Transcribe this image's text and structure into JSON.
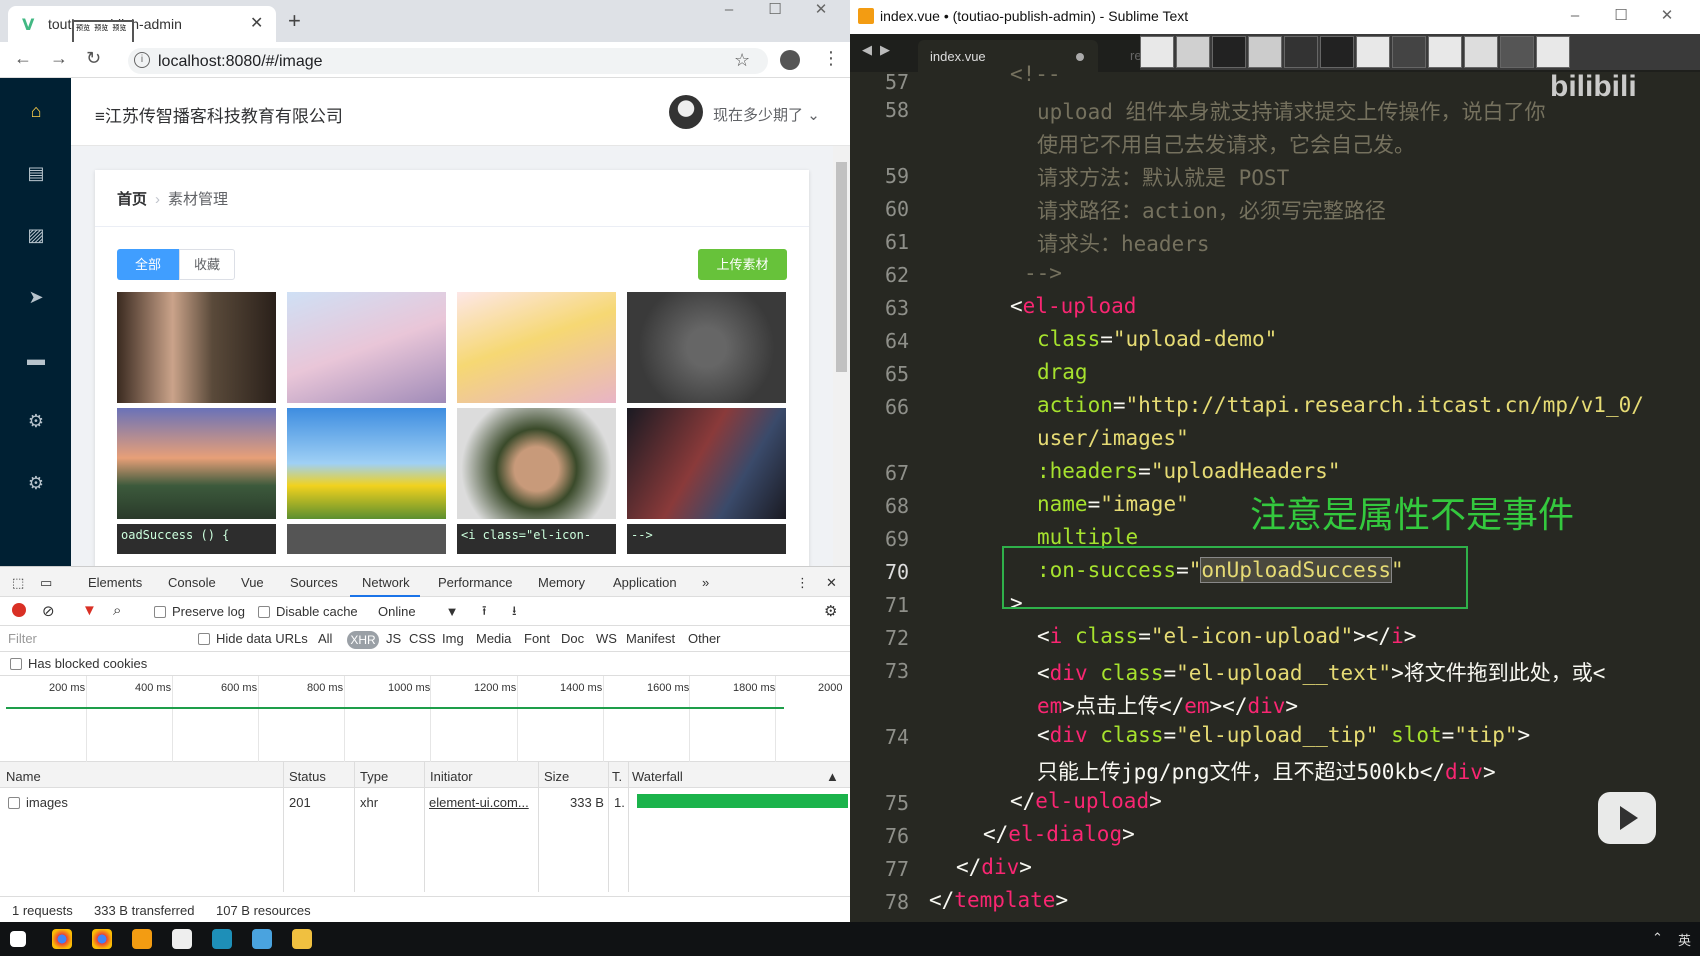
{
  "browser": {
    "tab_title": "toutiao-publish-admin",
    "thumb_popup": "预览 预览 预览",
    "url": "localhost:8080/#/image",
    "new_tab": "+"
  },
  "app": {
    "company": "江苏传智播客科技教育有限公司",
    "username": "现在多少期了",
    "breadcrumb": {
      "home": "首页",
      "current": "素材管理"
    },
    "radio_all": "全部",
    "radio_fav": "收藏",
    "upload_button": "上传素材",
    "partial_tiles": [
      "oadSuccess () {",
      "",
      "<i class=\"el-icon-",
      "-->"
    ]
  },
  "devtools": {
    "tabs": [
      "Elements",
      "Console",
      "Vue",
      "Sources",
      "Network",
      "Performance",
      "Memory",
      "Application",
      "»"
    ],
    "preserve_log": "Preserve log",
    "disable_cache": "Disable cache",
    "throttle": "Online",
    "filter_placeholder": "Filter",
    "hide_data_urls": "Hide data URLs",
    "types": [
      "All",
      "XHR",
      "JS",
      "CSS",
      "Img",
      "Media",
      "Font",
      "Doc",
      "WS",
      "Manifest",
      "Other"
    ],
    "blocked_cookies": "Has blocked cookies",
    "timeline_ticks": [
      "200 ms",
      "400 ms",
      "600 ms",
      "800 ms",
      "1000 ms",
      "1200 ms",
      "1400 ms",
      "1600 ms",
      "1800 ms",
      "2000"
    ],
    "columns": [
      "Name",
      "Status",
      "Type",
      "Initiator",
      "Size",
      "T.",
      "Waterfall"
    ],
    "row": {
      "name": "images",
      "status": "201",
      "type": "xhr",
      "initiator": "element-ui.com...",
      "size": "333 B",
      "time": "1."
    },
    "status": {
      "requests": "1 requests",
      "transferred": "333 B transferred",
      "resources": "107 B resources"
    }
  },
  "editor": {
    "title": "index.vue • (toutiao-publish-admin) - Sublime Text",
    "tab": "index.vue",
    "tab2": "request.js",
    "watermark": "bilibili",
    "note": "注意是属性不是事件"
  },
  "colors": {
    "sidebar": "#002033",
    "primary": "#409eff",
    "success": "#67c23a",
    "code_bg": "#272822"
  }
}
